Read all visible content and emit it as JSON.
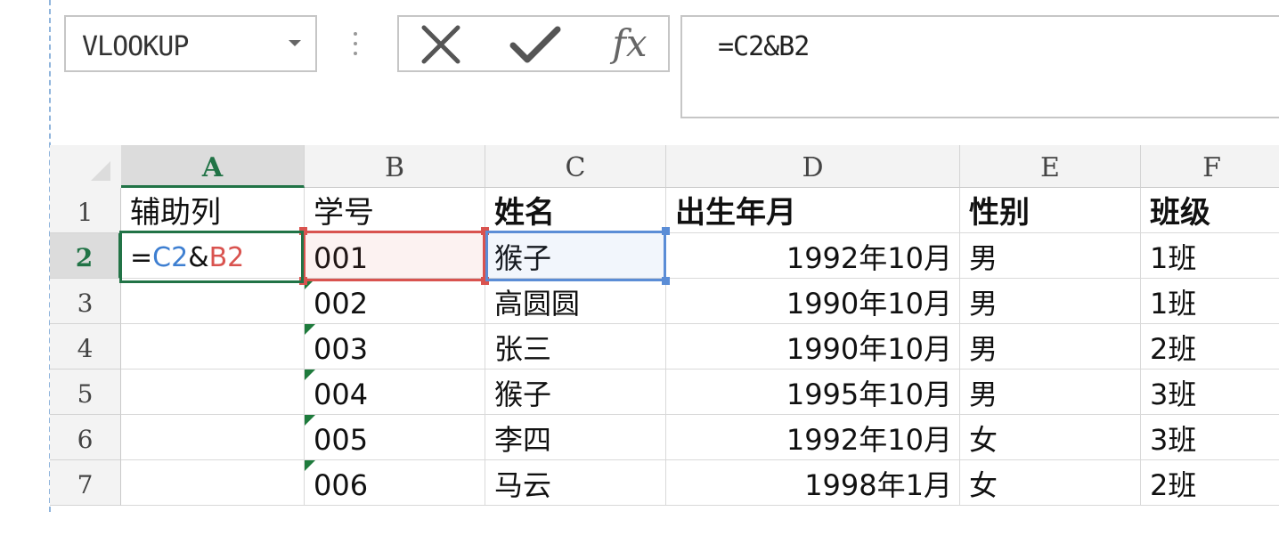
{
  "name_box": {
    "value": "VLOOKUP",
    "dropdown_icon": "chevron-down-icon"
  },
  "formula_bar": {
    "cancel_icon": "close-icon",
    "enter_icon": "check-icon",
    "fx_label": "fx",
    "formula": "=C2&B2"
  },
  "columns": [
    "A",
    "B",
    "C",
    "D",
    "E",
    "F"
  ],
  "active_column": "A",
  "rows": [
    {
      "num": "1",
      "cells": [
        "辅助列",
        "学号",
        "姓名",
        "出生年月",
        "性别",
        "班级"
      ]
    },
    {
      "num": "2",
      "cells": [
        "",
        "001",
        "猴子",
        "1992年10月",
        "男",
        "1班"
      ]
    },
    {
      "num": "3",
      "cells": [
        "",
        "002",
        "高圆圆",
        "1990年10月",
        "男",
        "1班"
      ]
    },
    {
      "num": "4",
      "cells": [
        "",
        "003",
        "张三",
        "1990年10月",
        "男",
        "2班"
      ]
    },
    {
      "num": "5",
      "cells": [
        "",
        "004",
        "猴子",
        "1995年10月",
        "男",
        "3班"
      ]
    },
    {
      "num": "6",
      "cells": [
        "",
        "005",
        "李四",
        "1992年10月",
        "女",
        "3班"
      ]
    },
    {
      "num": "7",
      "cells": [
        "",
        "006",
        "马云",
        "1998年1月",
        "女",
        "2班"
      ]
    }
  ],
  "active_row": "2",
  "editing_cell": {
    "address": "A2",
    "parts": {
      "eq": "=",
      "ref_c": "C2",
      "amp": "&",
      "ref_b": "B2"
    }
  },
  "colors": {
    "accent_green": "#217346",
    "ref_red": "#d9534f",
    "ref_blue": "#5b8dd6",
    "error_indicator": "#1e7b3c"
  }
}
